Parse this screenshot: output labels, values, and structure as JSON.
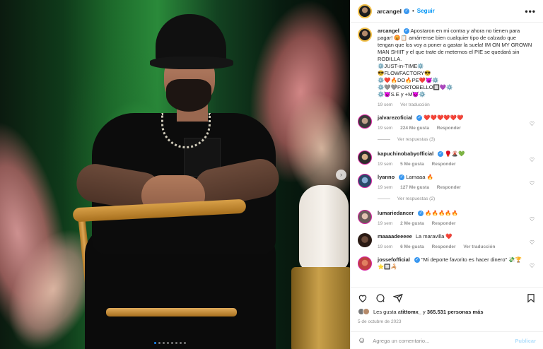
{
  "post": {
    "username": "arcangel",
    "follow_label": "Seguir",
    "more_label": "•••",
    "separator": "•",
    "carousel_next": "›",
    "carousel_dots": 8,
    "carousel_active": 1
  },
  "caption": {
    "username": "arcangel",
    "lines": [
      "Apostaron en mi contra y ahora no tienen para pagar! 😡📋 amárrense bien cualquier tipo de calzado que tengan que los voy a poner a gastar la suela! IM ON MY GROWN MAN SHIIT y el que trate de meternos el PIE se quedará sin RODILLA.",
      "⚙️JUST-in-TIME⚙️",
      "😎FLOWFACTORY😎",
      "⚙️❤️🔥DO🔥PE❤️😈⚙️",
      "⚙️🩶🩶PORTOBELLO🔲💜⚙️",
      "⚙️😈S.E y +M😈⚙️"
    ],
    "time": "19 sem",
    "translate": "Ver traducción"
  },
  "comments": [
    {
      "user": "jalvarezoficial",
      "verified": true,
      "text": "❤️❤️❤️❤️❤️❤️",
      "time": "19 sem",
      "likes": "224 Me gusta",
      "reply": "Responder",
      "translate": "",
      "replies_label": "Ver respuestas (3)"
    },
    {
      "user": "kapuchinobabyofficial",
      "verified": true,
      "text": "🥊🌋💚",
      "time": "19 sem",
      "likes": "5 Me gusta",
      "reply": "Responder",
      "translate": "",
      "replies_label": ""
    },
    {
      "user": "lyanno",
      "verified": true,
      "text": "Lamaaa 🔥",
      "time": "19 sem",
      "likes": "127 Me gusta",
      "reply": "Responder",
      "translate": "",
      "replies_label": "Ver respuestas (2)"
    },
    {
      "user": "lumariedancer",
      "verified": true,
      "text": "🔥🔥🔥🔥🔥",
      "time": "19 sem",
      "likes": "2 Me gusta",
      "reply": "Responder",
      "translate": "",
      "replies_label": ""
    },
    {
      "user": "maaaadeeeee",
      "verified": false,
      "text": "La maravilla ❤️",
      "time": "19 sem",
      "likes": "6 Me gusta",
      "reply": "Responder",
      "translate": "Ver traducción",
      "replies_label": ""
    },
    {
      "user": "jossefofficial",
      "verified": true,
      "text": "\"Mi deporte favorito es hacer dinero\" 💸🏆⭐🔲🦂",
      "time": "",
      "likes": "",
      "reply": "",
      "translate": "",
      "replies_label": ""
    }
  ],
  "likes": {
    "prefix": "Les gusta a ",
    "user": "tittomx_",
    "mid": " y ",
    "count": "365.531 personas más"
  },
  "date": "5 de octubre de 2023",
  "add_comment": {
    "placeholder": "Agrega un comentario...",
    "publish": "Publicar"
  },
  "icons": {
    "like": "heart-icon",
    "comment": "comment-icon",
    "share": "share-icon",
    "save": "bookmark-icon",
    "emoji": "emoji-icon"
  }
}
